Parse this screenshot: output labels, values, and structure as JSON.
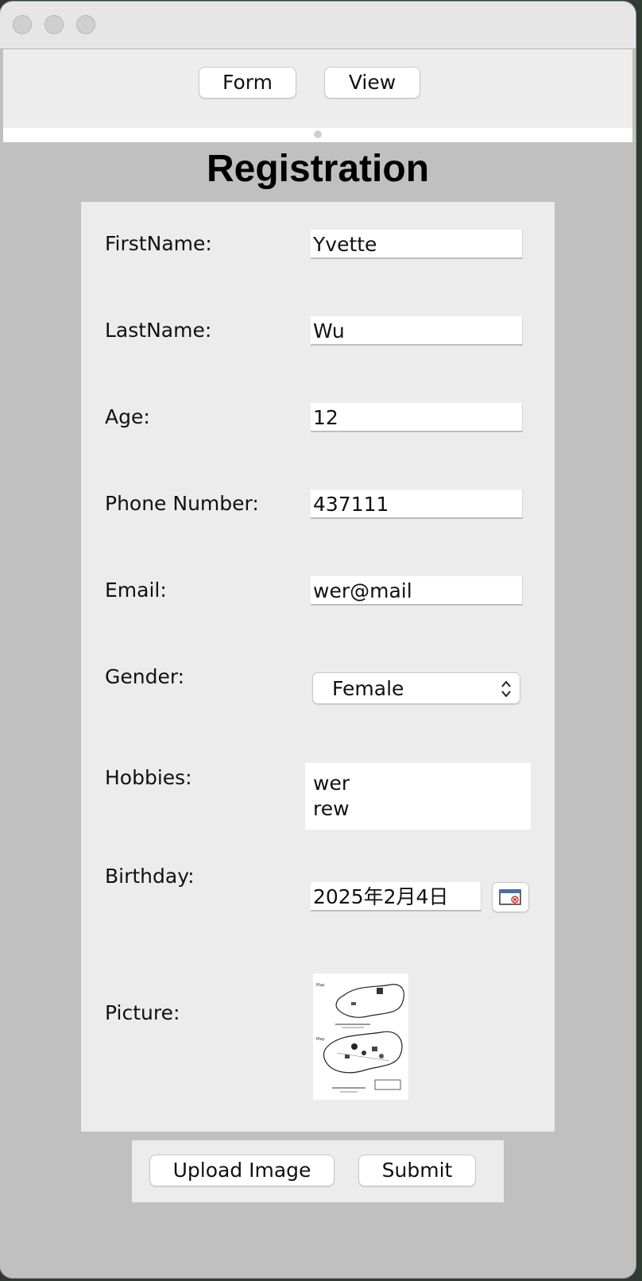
{
  "nav": {
    "form_label": "Form",
    "view_label": "View"
  },
  "page_title": "Registration",
  "fields": {
    "first_name": {
      "label": "FirstName:",
      "value": "Yvette"
    },
    "last_name": {
      "label": "LastName:",
      "value": "Wu"
    },
    "age": {
      "label": "Age:",
      "value": "12"
    },
    "phone": {
      "label": "Phone Number:",
      "value": "437111"
    },
    "email": {
      "label": "Email:",
      "value": "wer@mail"
    },
    "gender": {
      "label": "Gender:",
      "value": "Female"
    },
    "hobbies": {
      "label": "Hobbies:",
      "lines": [
        "wer",
        "rew"
      ]
    },
    "birthday": {
      "label": "Birthday:",
      "value": "2025年2月4日"
    },
    "picture": {
      "label": "Picture:"
    }
  },
  "actions": {
    "upload_label": "Upload Image",
    "submit_label": "Submit"
  }
}
